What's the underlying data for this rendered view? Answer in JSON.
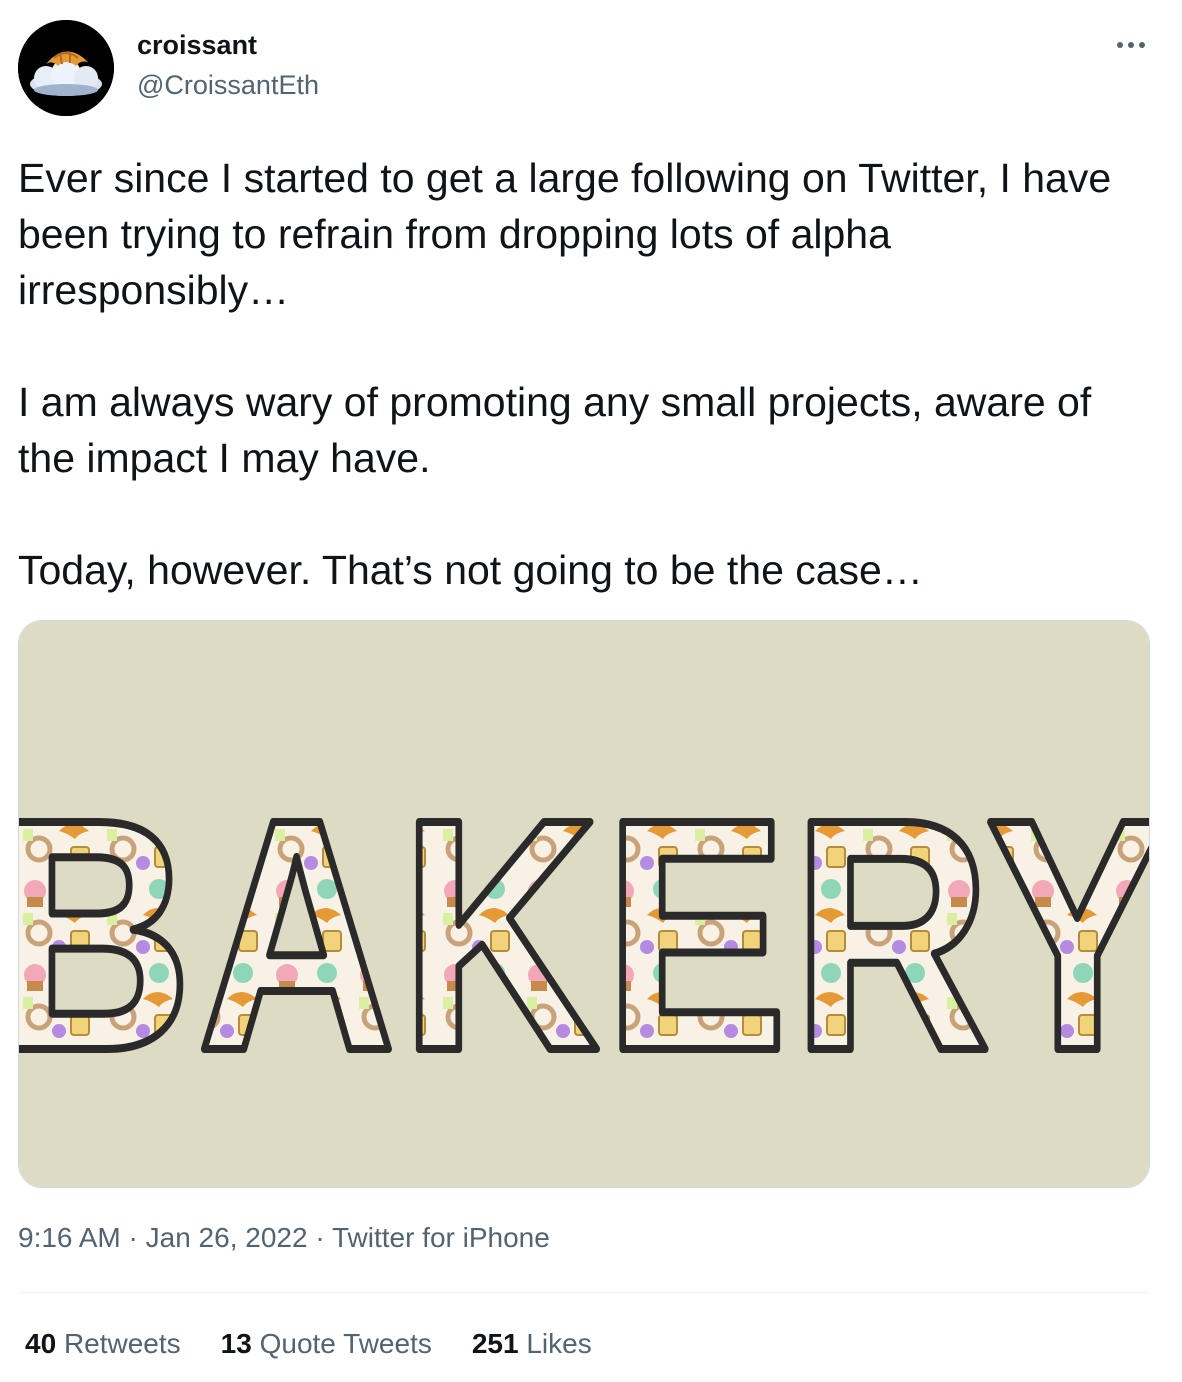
{
  "author": {
    "display_name": "croissant",
    "handle": "@CroissantEth",
    "avatar_icon": "croissant-on-cloud-icon"
  },
  "header": {
    "more_icon": "more-horizontal-icon"
  },
  "tweet": {
    "paragraphs": [
      "Ever since I started to get a large following on Twitter, I have been trying to refrain from dropping lots of alpha irresponsibly…",
      "I am always wary of promoting any small projects, aware of the impact I may have.",
      "Today, however. That’s not going to be the case…"
    ]
  },
  "media": {
    "word": "BAKERY",
    "background": "#dedbc4"
  },
  "meta": {
    "time": "9:16 AM",
    "date": "Jan 26, 2022",
    "source": "Twitter for iPhone",
    "separator": " · "
  },
  "stats": {
    "retweets": {
      "count": "40",
      "label": "Retweets"
    },
    "quote_tweets": {
      "count": "13",
      "label": "Quote Tweets"
    },
    "likes": {
      "count": "251",
      "label": "Likes"
    }
  },
  "colors": {
    "text": "#0f1419",
    "secondary": "#536471",
    "border": "#cfd9de",
    "divider": "#eff3f4"
  }
}
